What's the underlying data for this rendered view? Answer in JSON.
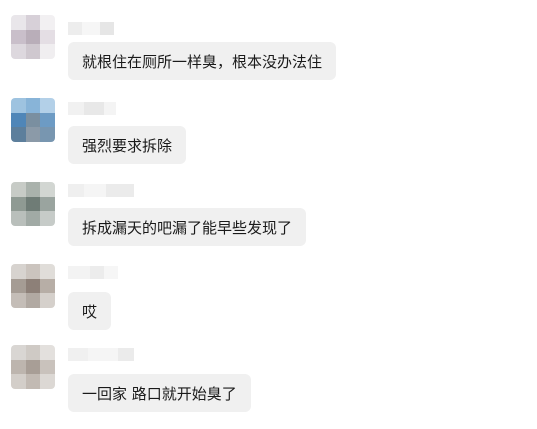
{
  "messages": [
    {
      "text": "就根住在厕所一样臭，根本没办法住"
    },
    {
      "text": "强烈要求拆除"
    },
    {
      "text": "拆成漏天的吧漏了能早些发现了"
    },
    {
      "text": "哎"
    },
    {
      "text": "一回家 路口就开始臭了"
    }
  ],
  "colors": {
    "bubble": "#f0f0f0",
    "text": "#1a1a1a",
    "background": "#ffffff"
  }
}
